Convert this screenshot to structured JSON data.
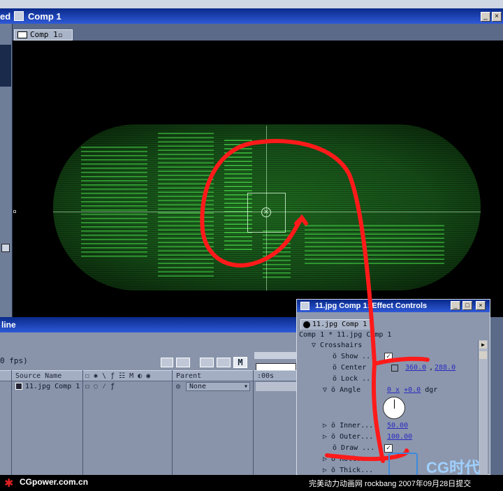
{
  "window": {
    "left_fragment": "ed",
    "title": "Comp 1",
    "minimize": "_",
    "close": "×"
  },
  "comp_tab": {
    "label": "Comp 1"
  },
  "timeline": {
    "title_fragment": "line",
    "fps_fragment": "0 fps)",
    "columns": {
      "source_name": "Source Name",
      "switches": "☐ ✱ \\ ƒ ☷ M ◐ ◉",
      "parent": "Parent",
      "time": ":00s"
    },
    "layer": {
      "name": "11.jpg Comp 1",
      "parent": "None"
    },
    "icons_m": "M"
  },
  "effect_controls": {
    "title": "11.jpg Comp 1: Effect Controls",
    "tab_label": "11.jpg Comp 1",
    "path": "Comp 1 * 11.jpg Comp 1",
    "effect_name": "Crosshairs",
    "props": [
      {
        "label": "Show ..."
      },
      {
        "label": "Center",
        "x": "360.0",
        "y": "288.0"
      },
      {
        "label": "Lock ..."
      },
      {
        "label": "Angle",
        "turns": "0 x",
        "degrees": "+0.0",
        "unit": "dgr"
      },
      {
        "label": "Inner...",
        "value": "50.00"
      },
      {
        "label": "Outer...",
        "value": "100.00"
      },
      {
        "label": "Draw ..."
      },
      {
        "label": "Roll..."
      },
      {
        "label": "Thick..."
      }
    ]
  },
  "watermark": {
    "logo": "CGpower.com.cn",
    "caption": "完美动力动画网 rockbang 2007年09月28日提交",
    "brand": "CG时代"
  },
  "colors": {
    "annotation": "#ff1a1a",
    "scope_green": "#1f6a1f",
    "titlebar": "#0a2a8a"
  }
}
